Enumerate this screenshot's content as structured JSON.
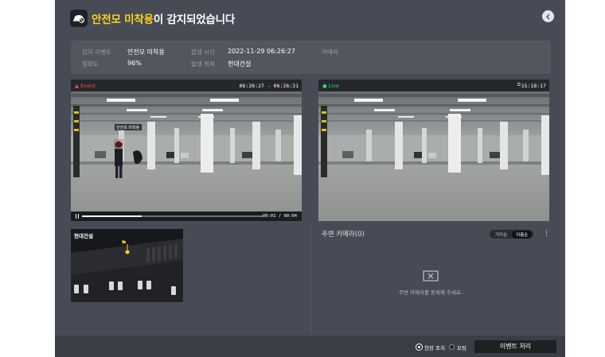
{
  "header": {
    "title_highlight": "안전모 미착용",
    "title_rest": "이 감지되었습니다"
  },
  "info": {
    "event_label": "감지 이벤트",
    "event_value": "안전모 미착용",
    "accuracy_label": "정확도",
    "accuracy_value": "96%",
    "time_label": "발생 시간",
    "time_value": "2022-11-29 06:26:27",
    "location_label": "발생 위치",
    "location_value": "현대건설",
    "camera_label": "카메라"
  },
  "event_video": {
    "badge": "Event",
    "time_range": "06:26:27 - 06:26:31",
    "detection_label": "안전모 미착용",
    "playback": "00:01 / 00:04",
    "progress": 0.33
  },
  "live_video": {
    "badge": "Live",
    "time": "15:18:17"
  },
  "map": {
    "title": "현대건설"
  },
  "nearby": {
    "title": "주변 카메라(0)",
    "sort_distance": "거리순",
    "sort_name": "이름순",
    "empty_message": "주변 카메라를 등록해 주세요."
  },
  "footer": {
    "option_onsite": "현장 조치",
    "option_monitor": "모팅",
    "process_button": "이벤트 처리"
  },
  "colors": {
    "highlight": "#ffd21e",
    "event_red": "#ff4d4d",
    "live_green": "#35d07f"
  }
}
